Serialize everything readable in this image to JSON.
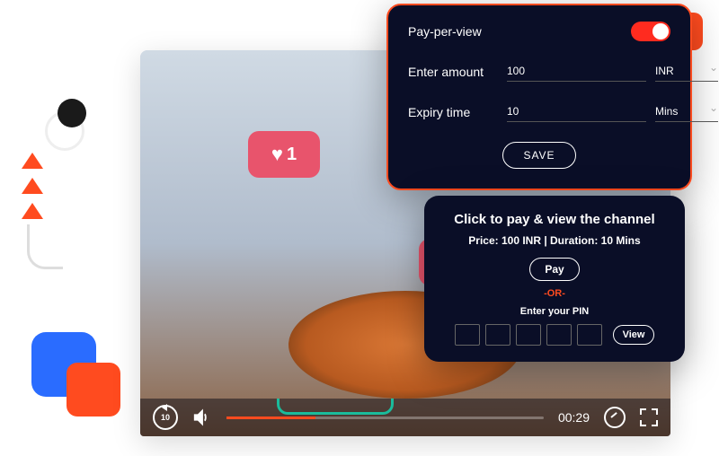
{
  "decorations": {
    "like1_count": "1"
  },
  "player": {
    "rewind_seconds": "10",
    "current_time": "00:29"
  },
  "ppv_config": {
    "toggle_label": "Pay-per-view",
    "amount_label": "Enter amount",
    "amount_value": "100",
    "currency": "INR",
    "expiry_label": "Expiry time",
    "expiry_value": "10",
    "expiry_unit": "Mins",
    "save_label": "SAVE"
  },
  "pay_view": {
    "title": "Click to pay & view the channel",
    "subtitle": "Price: 100 INR | Duration: 10 Mins",
    "pay_label": "Pay",
    "or_label": "-OR-",
    "pin_label": "Enter your PIN",
    "view_label": "View"
  }
}
